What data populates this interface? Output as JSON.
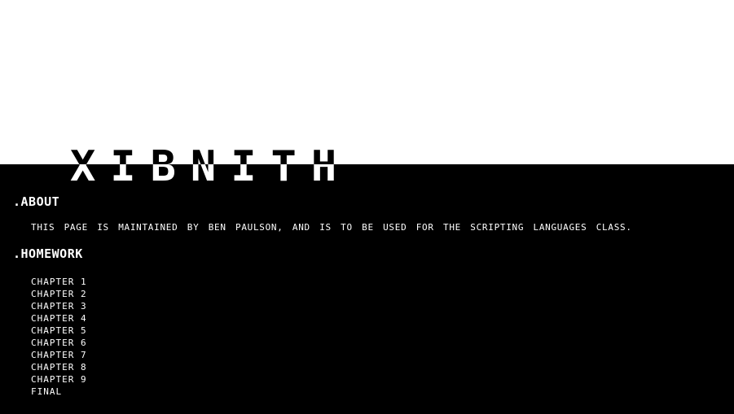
{
  "site": {
    "logo": "XIBNITH"
  },
  "about": {
    "heading": ".ABOUT",
    "text": "THIS PAGE IS MAINTAINED BY BEN PAULSON, AND IS TO BE USED FOR THE SCRIPTING LANGUAGES CLASS."
  },
  "homework": {
    "heading": ".HOMEWORK",
    "items": [
      "CHAPTER 1",
      "CHAPTER 2",
      "CHAPTER 3",
      "CHAPTER 4",
      "CHAPTER 5",
      "CHAPTER 6",
      "CHAPTER 7",
      "CHAPTER 8",
      "CHAPTER 9",
      "FINAL"
    ]
  },
  "colors": {
    "background": "#000000",
    "top_band": "#ffffff",
    "text": "#ffffff"
  }
}
